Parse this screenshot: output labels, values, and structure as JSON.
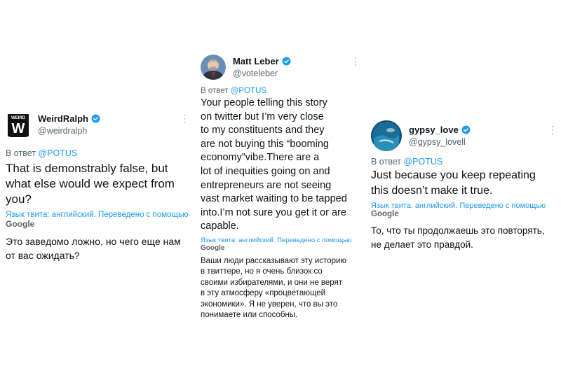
{
  "tweets": [
    {
      "name": "WeirdRalph",
      "handle": "@weirdralph",
      "reply_prefix": "В ответ",
      "reply_to": "@POTUS",
      "lines": [
        "That is demonstrably false, but",
        "what else would we expect from",
        "you?"
      ],
      "translate_label": "Язык твита: английский. Переведено с помощью",
      "google_label": "Google",
      "translation_lines": [
        "Это заведомо ложно, но чего еще нам",
        "от вас ожидать?"
      ],
      "more": "⋮"
    },
    {
      "name": "Matt Leber",
      "handle": "@voteleber",
      "reply_prefix": "В ответ",
      "reply_to": "@POTUS",
      "lines": [
        "Your people telling this story",
        "on twitter but I’m very close",
        "to my constituents and they",
        "are not buying this “booming",
        "economy”vibe.There are a",
        "lot of inequities going on and",
        "entrepreneurs are not seeing",
        "vast market waiting to be tapped",
        "into.I’m not sure you get it or are",
        "capable."
      ],
      "translate_label": "Язык твита: английский. Переведено с помощью",
      "google_label": "Google",
      "translation_lines": [
        "Ваши люди рассказывают эту историю",
        "в твиттере, но я очень близок со",
        "своими избирателями, и они не верят",
        "в эту атмосферу «процветающей",
        "экономики». Я не уверен, что вы это",
        "понимаете или способны."
      ],
      "more": "⋮"
    },
    {
      "name": "gypsy_love",
      "handle": "@gypsy_lovell",
      "reply_prefix": "В ответ",
      "reply_to": "@POTUS",
      "lines": [
        "Just because you keep repeating",
        "this doesn’t make it true."
      ],
      "translate_label": "Язык твита: английский. Переведено с помощью",
      "google_label": "Google",
      "translation_lines": [
        "То, что ты продолжаешь это повторять,",
        "не делает это правдой."
      ],
      "more": "⋮"
    }
  ],
  "colors": {
    "link": "#1d9bf0",
    "verified": "#1d9bf0",
    "secondary": "#536471",
    "text": "#0f1419"
  },
  "logo_text": "WEIRD"
}
